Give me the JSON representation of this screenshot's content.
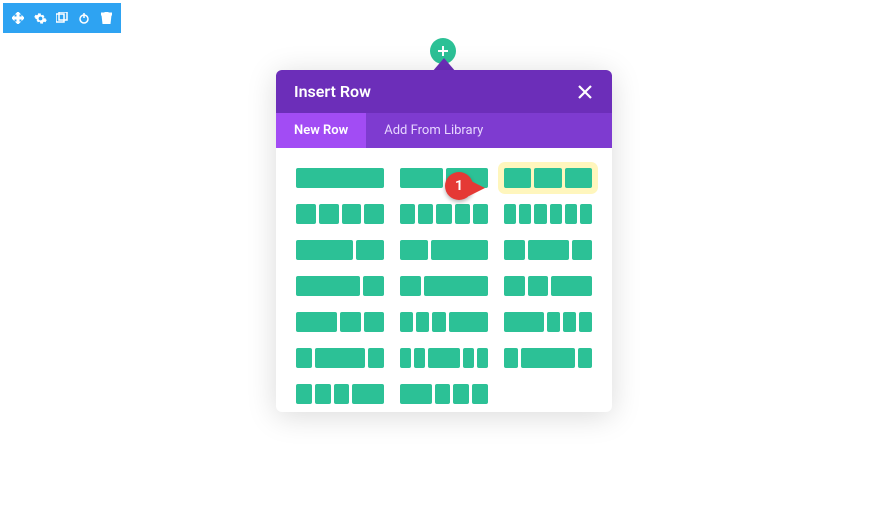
{
  "toolbar": {
    "icons": [
      "move-icon",
      "settings-icon",
      "duplicate-icon",
      "power-icon",
      "trash-icon"
    ]
  },
  "add_button": {
    "label": "+"
  },
  "modal": {
    "title": "Insert Row",
    "close_label": "×",
    "tabs": [
      {
        "label": "New Row",
        "active": true
      },
      {
        "label": "Add From Library",
        "active": false
      }
    ],
    "layouts": [
      {
        "cols": [
          1
        ],
        "highlight": false
      },
      {
        "cols": [
          1,
          1
        ],
        "highlight": false
      },
      {
        "cols": [
          1,
          1,
          1
        ],
        "highlight": true
      },
      {
        "cols": [
          1,
          1,
          1,
          1
        ],
        "highlight": false
      },
      {
        "cols": [
          1,
          1,
          1,
          1,
          1
        ],
        "highlight": false
      },
      {
        "cols": [
          1,
          1,
          1,
          1,
          1,
          1
        ],
        "highlight": false
      },
      {
        "cols": [
          2,
          1
        ],
        "highlight": false
      },
      {
        "cols": [
          1,
          2
        ],
        "highlight": false
      },
      {
        "cols": [
          1,
          2,
          1
        ],
        "highlight": false
      },
      {
        "cols": [
          3,
          1
        ],
        "highlight": false
      },
      {
        "cols": [
          1,
          3
        ],
        "highlight": false
      },
      {
        "cols": [
          1,
          1,
          2
        ],
        "highlight": false
      },
      {
        "cols": [
          2,
          1,
          1
        ],
        "highlight": false
      },
      {
        "cols": [
          1,
          1,
          1,
          3
        ],
        "highlight": false
      },
      {
        "cols": [
          3,
          1,
          1,
          1
        ],
        "highlight": false
      },
      {
        "cols": [
          1,
          3,
          1
        ],
        "highlight": false
      },
      {
        "cols": [
          1,
          1,
          3,
          1,
          1
        ],
        "highlight": false
      },
      {
        "cols": [
          1,
          4,
          1
        ],
        "highlight": false
      },
      {
        "cols": [
          1,
          1,
          1,
          2
        ],
        "highlight": false
      },
      {
        "cols": [
          2,
          1,
          1,
          1
        ],
        "highlight": false
      }
    ]
  },
  "callout": {
    "number": "1"
  },
  "colors": {
    "toolbar": "#2ea3f2",
    "accent": "#2cc196",
    "modal_header": "#6c2eb9",
    "tab_bar": "#7e3bd0",
    "tab_active": "#a24cf4",
    "highlight": "#fff6bd",
    "callout": "#e53935"
  }
}
